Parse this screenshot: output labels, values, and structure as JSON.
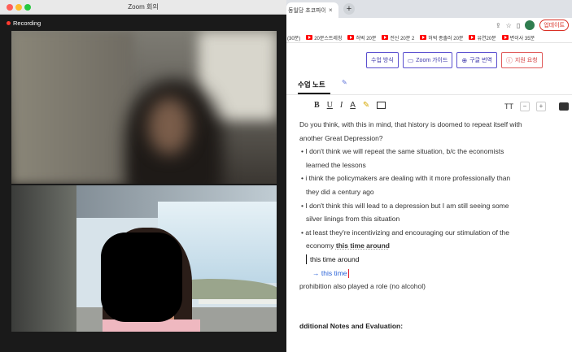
{
  "zoom": {
    "window_title": "Zoom 회의",
    "recording_label": "Recording"
  },
  "browser": {
    "tab_title": "동일당 초코파이 - ",
    "tab_close": "×",
    "new_tab": "+",
    "update_button": "업데이트",
    "bookmarks": [
      {
        "label": "(30분)",
        "icon": false
      },
      {
        "label": "20분스트레칭",
        "icon": true
      },
      {
        "label": "허벅 20분",
        "icon": true
      },
      {
        "label": "전신 20분 2",
        "icon": true
      },
      {
        "label": "허벅 종출러 20분",
        "icon": true
      },
      {
        "label": "유연20분",
        "icon": true
      },
      {
        "label": "변이사 35분",
        "icon": true
      }
    ]
  },
  "toolbar": {
    "buttons": [
      {
        "label": "수업 방식",
        "icon": "",
        "style": "purple"
      },
      {
        "label": "Zoom 가이드",
        "icon": "video-icon",
        "style": "purple"
      },
      {
        "label": "구글 번역",
        "icon": "globe-icon",
        "style": "purple"
      },
      {
        "label": "지원 요청",
        "icon": "info-icon",
        "style": "red"
      }
    ]
  },
  "notes": {
    "tab_label": "수업 노트",
    "format_buttons": [
      "B",
      "U",
      "I",
      "A"
    ],
    "text_size_label": "TT",
    "lines": [
      "Do you think, with this in mind, that history is doomed to repeat itself with",
      "another Great Depression?",
      "I don't think we will repeat the same situation, b/c the economists",
      "learned the lessons",
      "i think the policymakers are dealing with it more professionally than",
      "they did a century ago",
      "I don't think this will lead to a depression but I am still seeing some",
      "silver linings from this situation",
      "at least they're incentivizing and encouraging our stimulation of the",
      "economy ",
      "this time around",
      "this time around",
      "→ this time",
      "prohibition also played a role (no alcohol)"
    ],
    "additional_heading": "dditional Notes and Evaluation:"
  }
}
